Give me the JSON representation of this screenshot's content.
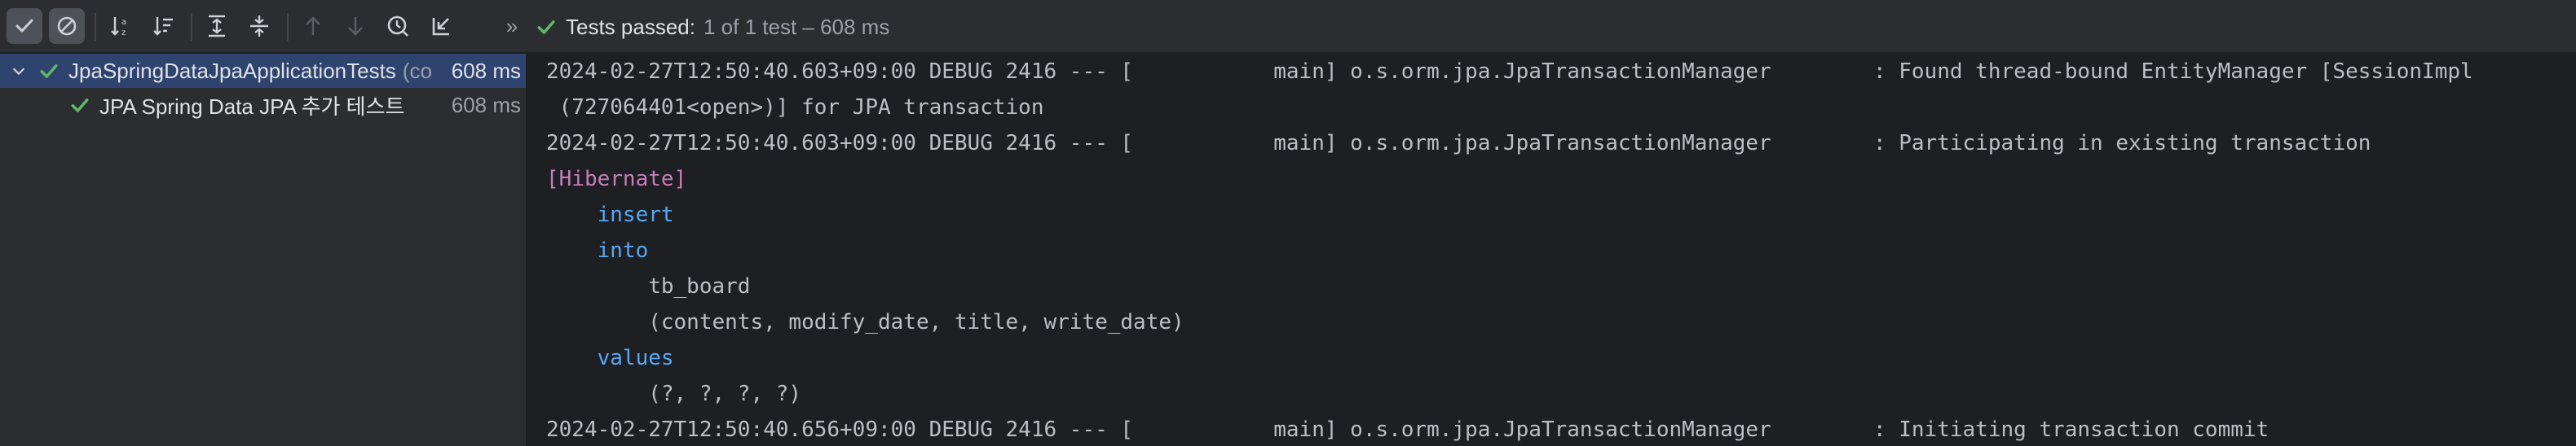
{
  "toolbar": {
    "buttons": [
      {
        "name": "show-passed-button",
        "icon": "check-icon",
        "active": true
      },
      {
        "name": "show-ignored-button",
        "icon": "ignored-icon",
        "active": true
      },
      {
        "name": "sort-alphabetically-button",
        "icon": "sort-alpha-icon"
      },
      {
        "name": "sort-by-duration-button",
        "icon": "sort-duration-icon"
      },
      {
        "name": "expand-all-button",
        "icon": "expand-all-icon"
      },
      {
        "name": "collapse-all-button",
        "icon": "collapse-all-icon"
      },
      {
        "name": "previous-failed-button",
        "icon": "arrow-up-icon",
        "disabled": true
      },
      {
        "name": "next-failed-button",
        "icon": "arrow-down-icon",
        "disabled": true
      },
      {
        "name": "test-history-button",
        "icon": "history-icon"
      },
      {
        "name": "import-tests-button",
        "icon": "import-icon"
      }
    ],
    "more_label": "»",
    "status": {
      "label": "Tests passed:",
      "detail": "1 of 1 test – 608 ms"
    }
  },
  "tree": {
    "items": [
      {
        "label": "JpaSpringDataJpaApplicationTests",
        "context": "(co",
        "duration": "608 ms",
        "selected": true,
        "expanded": true,
        "level": 0
      },
      {
        "label": "JPA Spring Data JPA 추가 테스트",
        "duration": "608 ms",
        "selected": false,
        "level": 1
      }
    ]
  },
  "console": {
    "lines": [
      {
        "type": "log",
        "text": "2024-02-27T12:50:40.603+09:00 DEBUG 2416 --- [           main] o.s.orm.jpa.JpaTransactionManager        : Found thread-bound EntityManager [SessionImpl"
      },
      {
        "type": "log",
        "text": " (727064401<open>)] for JPA transaction"
      },
      {
        "type": "log",
        "text": "2024-02-27T12:50:40.603+09:00 DEBUG 2416 --- [           main] o.s.orm.jpa.JpaTransactionManager        : Participating in existing transaction"
      },
      {
        "type": "hibernate",
        "text": "[Hibernate]"
      },
      {
        "type": "keyword",
        "text": "    insert"
      },
      {
        "type": "keyword",
        "text": "    into"
      },
      {
        "type": "sql",
        "text": "        tb_board"
      },
      {
        "type": "sql",
        "text": "        (contents, modify_date, title, write_date)"
      },
      {
        "type": "keyword",
        "text": "    values"
      },
      {
        "type": "sql",
        "text": "        (?, ?, ?, ?)"
      },
      {
        "type": "log",
        "text": "2024-02-27T12:50:40.656+09:00 DEBUG 2416 --- [           main] o.s.orm.jpa.JpaTransactionManager        : Initiating transaction commit"
      }
    ]
  },
  "colors": {
    "pass_green": "#5fb865",
    "hibernate_purple": "#c77dbb",
    "keyword_blue": "#56a8f5",
    "selection_blue": "#2e436e"
  }
}
